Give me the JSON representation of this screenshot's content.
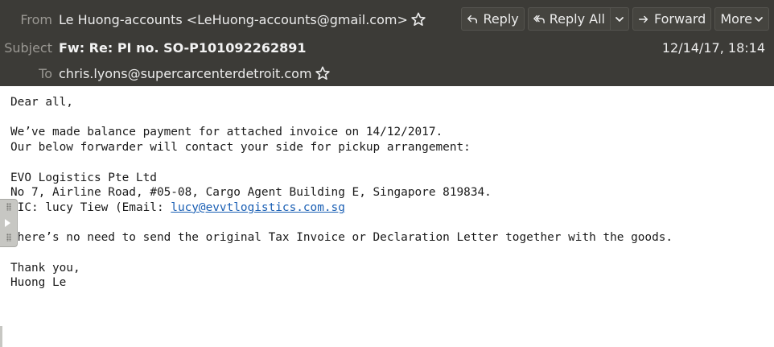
{
  "header": {
    "from_label": "From",
    "from_value": "Le Huong-accounts <LeHuong-accounts@gmail.com>",
    "subject_label": "Subject",
    "subject_value": "Fw: Re: PI no. SO-P101092262891",
    "to_label": "To",
    "to_value": "chris.lyons@supercarcenterdetroit.com",
    "date": "12/14/17, 18:14"
  },
  "buttons": {
    "reply": "Reply",
    "reply_all": "Reply All",
    "forward": "Forward",
    "more": "More"
  },
  "icons": {
    "star": "star-outline-icon",
    "reply": "reply-arrow-icon",
    "reply_all": "reply-all-arrow-icon",
    "forward": "forward-arrow-icon",
    "dropdown": "chevron-down-icon"
  },
  "body": {
    "line1": "Dear all,",
    "line2": "We’ve made balance payment for attached invoice on 14/12/2017.",
    "line3": "Our below forwarder will contact your side for pickup arrangement:",
    "line4": "EVO Logistics Pte Ltd",
    "line5": "No 7, Airline Road, #05-08, Cargo Agent Building E, Singapore 819834.",
    "line6_prefix": "PIC: lucy Tiew (Email: ",
    "email_link": "lucy@evvtlogistics.com.sg",
    "line7": "There’s no need to send the original Tax Invoice or Declaration Letter together with the goods.",
    "line8": "Thank you,",
    "line9": "Huong Le"
  },
  "colors": {
    "header_bg": "#3c3b37",
    "link": "#1a5fb4"
  }
}
